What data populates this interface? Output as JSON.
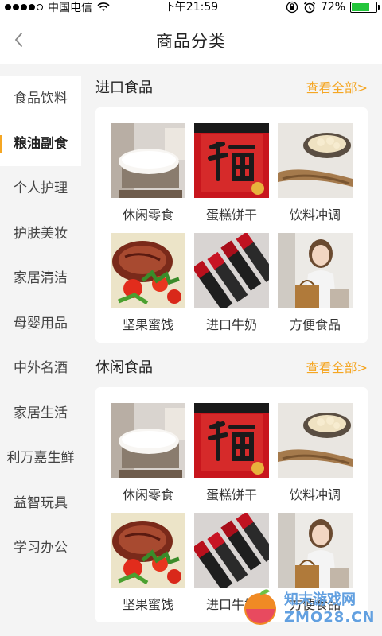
{
  "status_bar": {
    "carrier": "中国电信",
    "time": "下午21:59",
    "battery": "72%",
    "battery_level": 0.72,
    "signal_bars": 4,
    "icons": [
      "signal-dots-icon",
      "wifi-icon",
      "rotation-lock-icon",
      "alarm-icon",
      "battery-icon"
    ]
  },
  "nav": {
    "title": "商品分类",
    "back_icon": "chevron-left-icon"
  },
  "sidebar": {
    "items": [
      {
        "label": "食品饮料"
      },
      {
        "label": "粮油副食"
      },
      {
        "label": "个人护理"
      },
      {
        "label": "护肤美妆"
      },
      {
        "label": "家居清洁"
      },
      {
        "label": "母婴用品"
      },
      {
        "label": "中外名酒"
      },
      {
        "label": "家居生活"
      },
      {
        "label": "利万嘉生鲜"
      },
      {
        "label": "益智玩具"
      },
      {
        "label": "学习办公"
      }
    ],
    "active_index": 1
  },
  "sections": [
    {
      "title": "进口食品",
      "more_label": "查看全部>",
      "items": [
        {
          "label": "休闲零食",
          "image": "pillow"
        },
        {
          "label": "蛋糕饼干",
          "image": "fu-card"
        },
        {
          "label": "饮料冲调",
          "image": "ginseng"
        },
        {
          "label": "坚果蜜饯",
          "image": "steak"
        },
        {
          "label": "进口牛奶",
          "image": "lipsticks"
        },
        {
          "label": "方便食品",
          "image": "woman-shopping"
        }
      ]
    },
    {
      "title": "休闲食品",
      "more_label": "查看全部>",
      "items": [
        {
          "label": "休闲零食",
          "image": "pillow"
        },
        {
          "label": "蛋糕饼干",
          "image": "fu-card"
        },
        {
          "label": "饮料冲调",
          "image": "ginseng"
        },
        {
          "label": "坚果蜜饯",
          "image": "steak"
        },
        {
          "label": "进口牛奶",
          "image": "lipsticks"
        },
        {
          "label": "方便食品",
          "image": "woman-shopping"
        }
      ]
    }
  ],
  "watermark": {
    "line1": "知末游戏网",
    "line2": "ZMO28.CN"
  },
  "colors": {
    "accent": "#f5a623",
    "page_bg": "#f4f4f4",
    "card_bg": "#ffffff"
  }
}
